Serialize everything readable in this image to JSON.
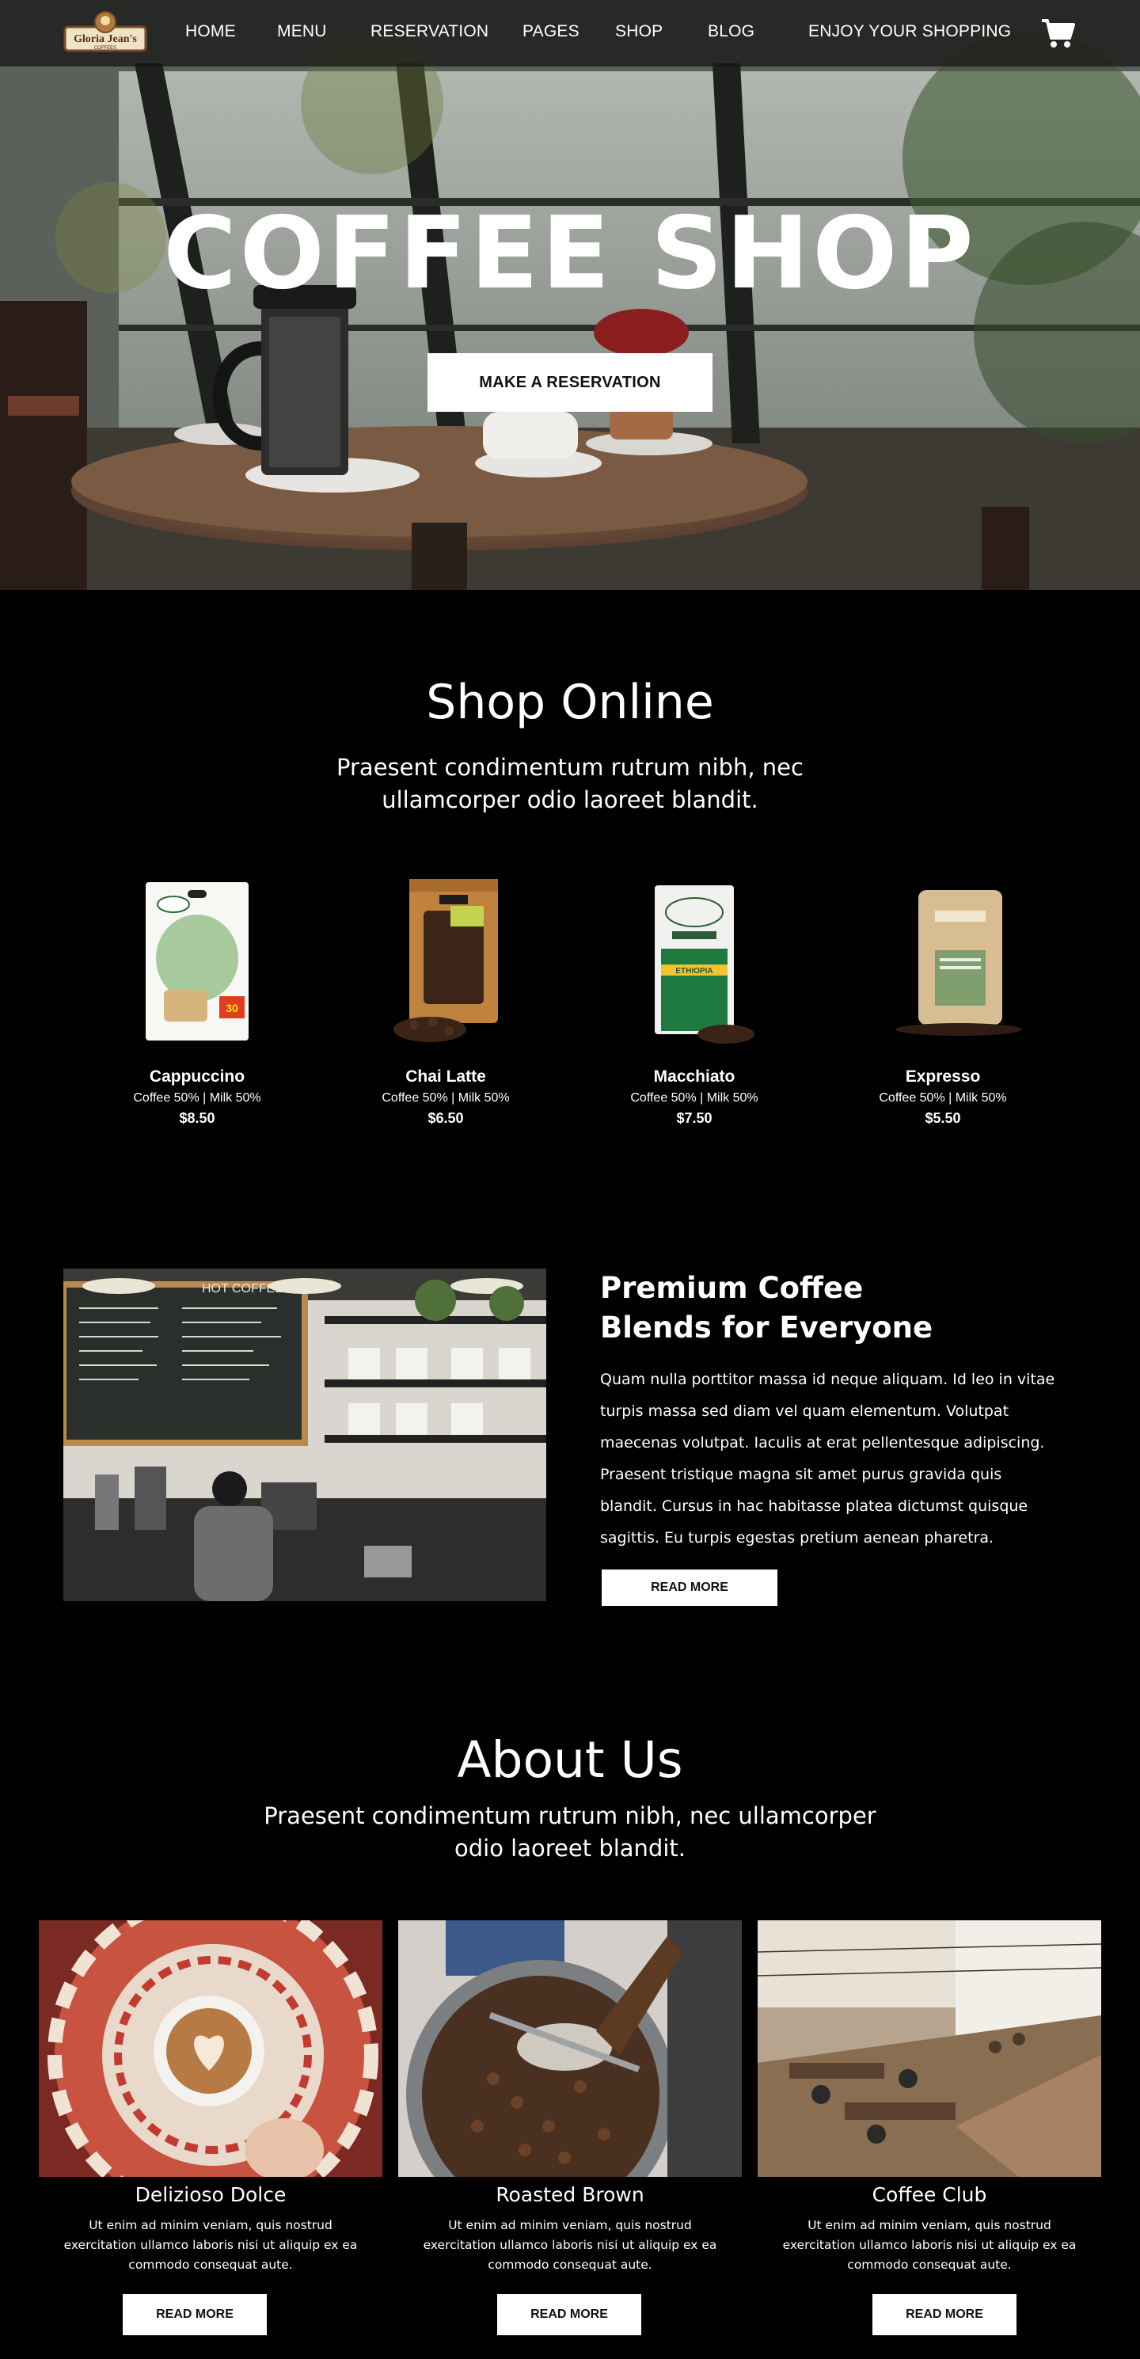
{
  "nav": {
    "logo_text": "Gloria Jean's",
    "logo_sub": "COFFEES",
    "items": [
      "HOME",
      "MENU",
      "RESERVATION",
      "PAGES",
      "SHOP",
      "BLOG"
    ],
    "promo": "ENJOY YOUR SHOPPING",
    "cart_icon": "shopping-cart-icon"
  },
  "hero": {
    "title": "COFFEE SHOP",
    "button_label": "MAKE A RESERVATION"
  },
  "shop": {
    "title": "Shop Online",
    "subtitle_line1": "Praesent condimentum rutrum nibh, nec",
    "subtitle_line2": "ullamcorper odio laoreet blandit.",
    "products": [
      {
        "name": "Cappuccino",
        "desc": "Coffee 50% | Milk 50%",
        "price": "$8.50",
        "bag_label": "30"
      },
      {
        "name": "Chai Latte",
        "desc": "Coffee 50% | Milk 50%",
        "price": "$6.50",
        "bag_label": ""
      },
      {
        "name": "Macchiato",
        "desc": "Coffee 50% | Milk 50%",
        "price": "$7.50",
        "bag_label": "ETHIOPIA"
      },
      {
        "name": "Expresso",
        "desc": "Coffee 50% | Milk 50%",
        "price": "$5.50",
        "bag_label": ""
      }
    ]
  },
  "premium": {
    "title_line1": "Premium Coffee",
    "title_line2": "Blends for Everyone",
    "lines": [
      "Quam nulla porttitor massa id neque aliquam. Id leo in vitae",
      "turpis massa sed diam vel quam elementum. Volutpat",
      "maecenas volutpat. Iaculis at erat pellentesque adipiscing.",
      "Praesent tristique magna sit amet purus gravida quis",
      "blandit. Cursus in hac habitasse platea dictumst quisque",
      "sagittis. Eu turpis egestas pretium aenean pharetra."
    ],
    "button_label": "READ MORE",
    "menu_board_title": "HOT COFFEE"
  },
  "about": {
    "title": "About Us",
    "subtitle_line1": "Praesent condimentum rutrum nibh, nec ullamcorper",
    "subtitle_line2": "odio laoreet blandit.",
    "cards": [
      {
        "title": "Delizioso Dolce",
        "line1": "Ut enim ad minim veniam, quis nostrud",
        "line2": "exercitation ullamco laboris nisi ut aliquip ex ea",
        "line3": "commodo consequat aute.",
        "button_label": "READ MORE"
      },
      {
        "title": "Roasted Brown",
        "line1": "Ut enim ad minim veniam, quis nostrud",
        "line2": "exercitation ullamco laboris nisi ut aliquip ex ea",
        "line3": "commodo consequat aute.",
        "button_label": "READ MORE"
      },
      {
        "title": "Coffee Club",
        "line1": "Ut enim ad minim veniam, quis nostrud",
        "line2": "exercitation ullamco laboris nisi ut aliquip ex ea",
        "line3": "commodo consequat aute.",
        "button_label": "READ MORE"
      }
    ]
  }
}
